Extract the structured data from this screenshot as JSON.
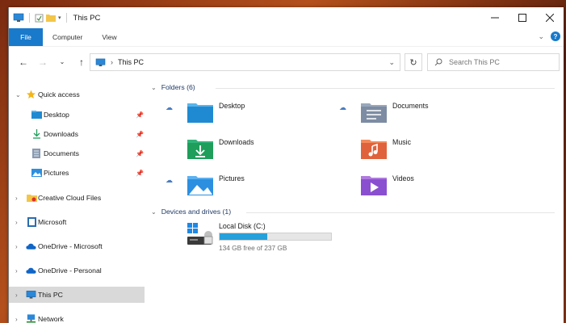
{
  "window": {
    "title": "This PC"
  },
  "ribbon": {
    "file": "File",
    "computer": "Computer",
    "view": "View"
  },
  "address": {
    "path": "This PC"
  },
  "search": {
    "placeholder": "Search This PC"
  },
  "nav": {
    "quick_access": "Quick access",
    "quick_items": [
      {
        "label": "Desktop",
        "icon": "desktop-folder-icon"
      },
      {
        "label": "Downloads",
        "icon": "downloads-icon"
      },
      {
        "label": "Documents",
        "icon": "documents-icon"
      },
      {
        "label": "Pictures",
        "icon": "pictures-icon"
      }
    ],
    "items": [
      {
        "label": "Creative Cloud Files",
        "icon": "creative-cloud-icon"
      },
      {
        "label": "Microsoft",
        "icon": "microsoft-folder-icon"
      },
      {
        "label": "OneDrive - Microsoft",
        "icon": "onedrive-icon"
      },
      {
        "label": "OneDrive - Personal",
        "icon": "onedrive-icon"
      },
      {
        "label": "This PC",
        "icon": "this-pc-icon",
        "selected": true
      },
      {
        "label": "Network",
        "icon": "network-icon"
      }
    ]
  },
  "content": {
    "folders_header": "Folders (6)",
    "folders": [
      {
        "name": "Desktop",
        "icon": "desktop-folder-icon",
        "cloud": true
      },
      {
        "name": "Documents",
        "icon": "documents-folder-icon",
        "cloud": true
      },
      {
        "name": "Downloads",
        "icon": "downloads-folder-icon",
        "cloud": false
      },
      {
        "name": "Music",
        "icon": "music-folder-icon",
        "cloud": false
      },
      {
        "name": "Pictures",
        "icon": "pictures-folder-icon",
        "cloud": true
      },
      {
        "name": "Videos",
        "icon": "videos-folder-icon",
        "cloud": false
      }
    ],
    "devices_header": "Devices and drives (1)",
    "drive": {
      "name": "Local Disk (C:)",
      "free_text": "134 GB free of 237 GB",
      "used_fraction": 0.43
    }
  },
  "colors": {
    "accent": "#1979ca",
    "selection": "#d9d9d9",
    "drive_bar": "#26a0da"
  }
}
